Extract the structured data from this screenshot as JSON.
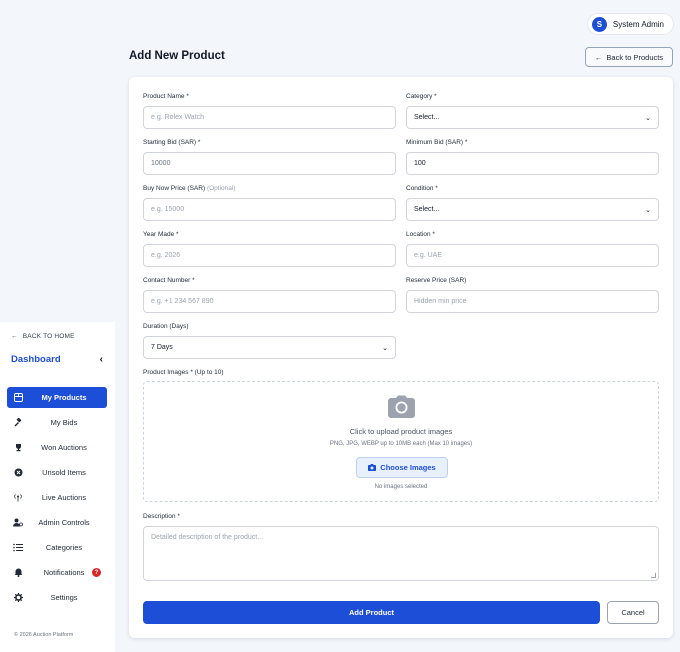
{
  "header": {
    "user_initial": "S",
    "user_name": "System Admin"
  },
  "page": {
    "title": "Add New Product",
    "back_button": "Back to Products"
  },
  "sidebar": {
    "back_home": "BACK TO HOME",
    "title": "Dashboard",
    "items": [
      {
        "label": "My Products",
        "icon": "grid-icon",
        "active": true
      },
      {
        "label": "My Bids",
        "icon": "gavel-icon"
      },
      {
        "label": "Won Auctions",
        "icon": "trophy-icon"
      },
      {
        "label": "Unsold Items",
        "icon": "x-circle-icon"
      },
      {
        "label": "Live Auctions",
        "icon": "broadcast-icon"
      },
      {
        "label": "Admin Controls",
        "icon": "user-gear-icon"
      },
      {
        "label": "Categories",
        "icon": "list-icon"
      },
      {
        "label": "Notifications",
        "icon": "bell-icon",
        "badge": "?"
      },
      {
        "label": "Settings",
        "icon": "gear-icon"
      }
    ],
    "footer": "© 2026 Auction Platform"
  },
  "form": {
    "product_name": {
      "label": "Product Name *",
      "placeholder": "e.g. Rolex Watch"
    },
    "category": {
      "label": "Category *",
      "value": "Select..."
    },
    "starting_bid": {
      "label": "Starting Bid (SAR) *",
      "value": "10000"
    },
    "minimum_bid": {
      "label": "Minimum Bid (SAR) *",
      "value": "100"
    },
    "buy_now": {
      "label": "Buy Now Price (SAR)",
      "optional": "(Optional)",
      "placeholder": "e.g. 15000"
    },
    "condition": {
      "label": "Condition *",
      "value": "Select..."
    },
    "year_made": {
      "label": "Year Made *",
      "placeholder": "e.g. 2026"
    },
    "location": {
      "label": "Location *",
      "placeholder": "e.g. UAE"
    },
    "contact": {
      "label": "Contact Number *",
      "placeholder": "e.g. +1 234 567 890"
    },
    "reserve": {
      "label": "Reserve Price (SAR)",
      "placeholder": "Hidden min price"
    },
    "duration": {
      "label": "Duration (Days)",
      "value": "7 Days"
    },
    "images": {
      "label": "Product Images * (Up to 10)",
      "title": "Click to upload product images",
      "subtitle": "PNG, JPG, WEBP up to 10MB each (Max 10 images)",
      "button": "Choose Images",
      "status": "No images selected"
    },
    "description": {
      "label": "Description *",
      "placeholder": "Detailed description of the product..."
    },
    "submit": "Add Product",
    "cancel": "Cancel"
  },
  "colors": {
    "accent": "#1d4ed8",
    "badge": "#dc2626",
    "background": "#f3f6fb"
  }
}
